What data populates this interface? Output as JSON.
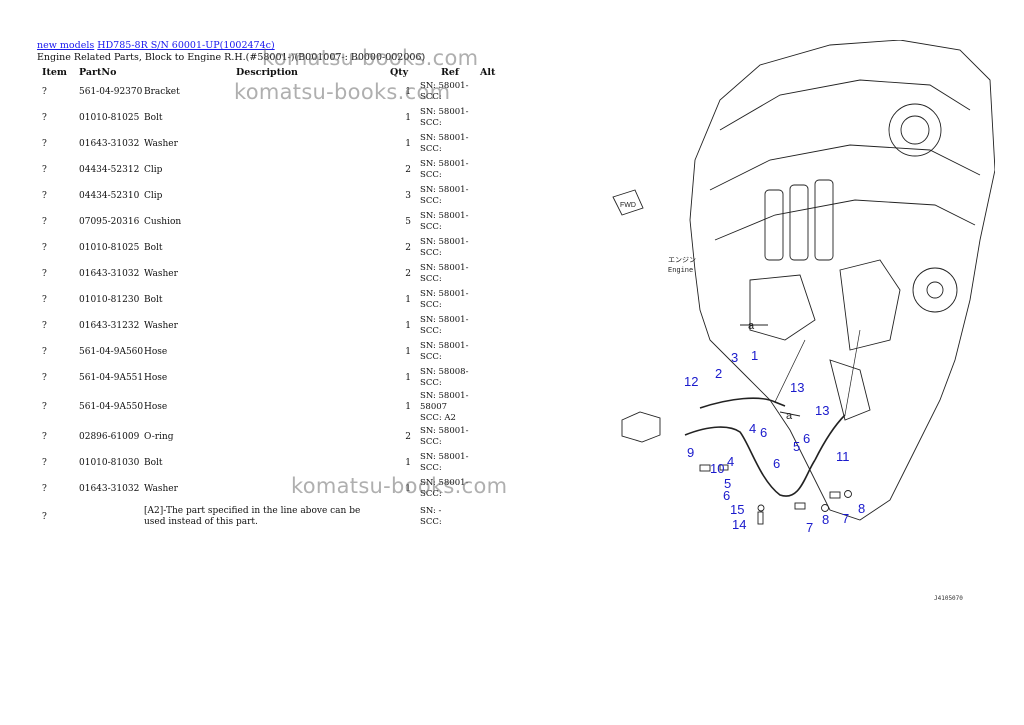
{
  "breadcrumb": {
    "link1": "new models",
    "link2": "HD785-8R S/N 60001-UP(1002474c)"
  },
  "subtitle": "Engine Related Parts, Block to Engine R.H.(#58001-)(B001007-: B0000-002006)",
  "columns": [
    "Item",
    "PartNo",
    "Description",
    "Qty",
    "Ref",
    "Alt"
  ],
  "rows": [
    {
      "item": "?",
      "part": "561-04-92370",
      "desc": "Bracket",
      "qty": "1",
      "ref": "SN: 58001-\nSCC:"
    },
    {
      "item": "?",
      "part": "01010-81025",
      "desc": "Bolt",
      "qty": "1",
      "ref": "SN: 58001-\nSCC:"
    },
    {
      "item": "?",
      "part": "01643-31032",
      "desc": "Washer",
      "qty": "1",
      "ref": "SN: 58001-\nSCC:"
    },
    {
      "item": "?",
      "part": "04434-52312",
      "desc": "Clip",
      "qty": "2",
      "ref": "SN: 58001-\nSCC:"
    },
    {
      "item": "?",
      "part": "04434-52310",
      "desc": "Clip",
      "qty": "3",
      "ref": "SN: 58001-\nSCC:"
    },
    {
      "item": "?",
      "part": "07095-20316",
      "desc": "Cushion",
      "qty": "5",
      "ref": "SN: 58001-\nSCC:"
    },
    {
      "item": "?",
      "part": "01010-81025",
      "desc": "Bolt",
      "qty": "2",
      "ref": "SN: 58001-\nSCC:"
    },
    {
      "item": "?",
      "part": "01643-31032",
      "desc": "Washer",
      "qty": "2",
      "ref": "SN: 58001-\nSCC:"
    },
    {
      "item": "?",
      "part": "01010-81230",
      "desc": "Bolt",
      "qty": "1",
      "ref": "SN: 58001-\nSCC:"
    },
    {
      "item": "?",
      "part": "01643-31232",
      "desc": "Washer",
      "qty": "1",
      "ref": "SN: 58001-\nSCC:"
    },
    {
      "item": "?",
      "part": "561-04-9A560",
      "desc": "Hose",
      "qty": "1",
      "ref": "SN: 58001-\nSCC:"
    },
    {
      "item": "?",
      "part": "561-04-9A551",
      "desc": "Hose",
      "qty": "1",
      "ref": "SN: 58008-\nSCC:"
    },
    {
      "item": "?",
      "part": "561-04-9A550",
      "desc": "Hose",
      "qty": "1",
      "ref": "SN: 58001-58007\nSCC: A2"
    },
    {
      "item": "?",
      "part": "02896-61009",
      "desc": "O-ring",
      "qty": "2",
      "ref": "SN: 58001-\nSCC:"
    },
    {
      "item": "?",
      "part": "01010-81030",
      "desc": "Bolt",
      "qty": "1",
      "ref": "SN: 58001-\nSCC:"
    },
    {
      "item": "?",
      "part": "01643-31032",
      "desc": "Washer",
      "qty": "1",
      "ref": "SN: 58001-\nSCC:"
    },
    {
      "item": "?",
      "part": "",
      "desc": "[A2]-The part specified in the line above can be used instead of this part.",
      "qty": "",
      "ref": "SN: -\nSCC:"
    }
  ],
  "watermarks": [
    "komatsu-books.com",
    "komatsu-books.com",
    "komatsu-books.com"
  ],
  "diagram": {
    "fwd_label": "FWD",
    "engine_jp": "エンジン",
    "engine_en": "Engine",
    "arrow_label_a": "a",
    "arrow_label_a2": "a",
    "callouts": [
      "1",
      "2",
      "3",
      "4",
      "5",
      "6",
      "7",
      "8",
      "9",
      "10",
      "11",
      "12",
      "13",
      "14",
      "15"
    ],
    "callout_13b": "13",
    "callout_4b": "4",
    "callout_5b": "5",
    "callout_6b": "6",
    "callout_6c": "6",
    "callout_7b": "7",
    "callout_8b": "8",
    "diagram_id": "J4105070"
  },
  "colors": {
    "link": "#1a1aee",
    "callout": "#1a1acc"
  }
}
